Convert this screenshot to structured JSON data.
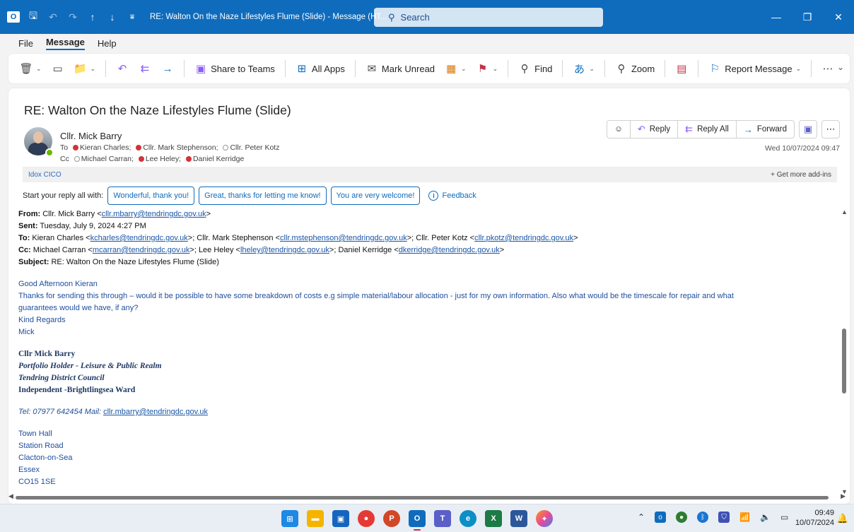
{
  "window": {
    "title": "RE: Walton On the Naze Lifestyles Flume (Slide)  -  Message (HT...",
    "search_placeholder": "Search",
    "controls": [
      "minimize-icon",
      "restore-icon",
      "close-icon"
    ]
  },
  "menu": {
    "items": [
      "File",
      "Message",
      "Help"
    ],
    "active": "Message"
  },
  "ribbon": {
    "share_to_teams": "Share to Teams",
    "all_apps": "All Apps",
    "mark_unread": "Mark Unread",
    "find": "Find",
    "zoom": "Zoom",
    "report_message": "Report Message"
  },
  "message": {
    "subject": "RE: Walton On the Naze Lifestyles Flume (Slide)",
    "sender": "Cllr. Mick Barry",
    "to_label": "To",
    "to": [
      {
        "name": "Kieran Charles;",
        "status": "busy"
      },
      {
        "name": "Cllr. Mark Stephenson;",
        "status": "busy"
      },
      {
        "name": "Cllr. Peter Kotz",
        "status": "offline"
      }
    ],
    "cc_label": "Cc",
    "cc": [
      {
        "name": "Michael Carran;",
        "status": "offline"
      },
      {
        "name": "Lee Heley;",
        "status": "busy"
      },
      {
        "name": "Daniel Kerridge",
        "status": "busy"
      }
    ],
    "date": "Wed 10/07/2024 09:47",
    "actions": {
      "reply": "Reply",
      "reply_all": "Reply All",
      "forward": "Forward"
    }
  },
  "addin": {
    "name": "Idox CICO",
    "more": "Get more add-ins"
  },
  "quick_reply": {
    "label": "Start your reply all with:",
    "options": [
      "Wonderful, thank you!",
      "Great, thanks for letting me know!",
      "You are very welcome!"
    ],
    "feedback": "Feedback"
  },
  "quoted": {
    "from_label": "From:",
    "from_name": "Cllr. Mick Barry <",
    "from_email": "cllr.mbarry@tendringdc.gov.uk",
    "from_tail": ">",
    "sent_label": "Sent:",
    "sent": "Tuesday, July 9, 2024 4:27 PM",
    "to_label": "To:",
    "to_1": "Kieran Charles <",
    "to_1_email": "kcharles@tendringdc.gov.uk",
    "to_2": ">; Cllr. Mark Stephenson <",
    "to_2_email": "cllr.mstephenson@tendringdc.gov.uk",
    "to_3": ">; Cllr. Peter Kotz <",
    "to_3_email": "cllr.pkotz@tendringdc.gov.uk",
    "to_tail": ">",
    "cc_label": "Cc:",
    "cc_1": "Michael Carran <",
    "cc_1_email": "mcarran@tendringdc.gov.uk",
    "cc_2": ">; Lee Heley <",
    "cc_2_email": "lheley@tendringdc.gov.uk",
    "cc_3": ">; Daniel Kerridge <",
    "cc_3_email": "dkerridge@tendringdc.gov.uk",
    "cc_tail": ">",
    "subject_label": "Subject:",
    "subject": "RE: Walton On the Naze Lifestyles Flume (Slide)"
  },
  "body": {
    "greeting": "Good Afternoon Kieran",
    "para_1": "Thanks for sending this through – would it be possible to have some breakdown of costs e.g simple material/labour allocation - just for my own information. Also what would be the timescale for repair and what",
    "para_2": "guarantees would we have, if any?",
    "regards": "Kind Regards",
    "name": "Mick"
  },
  "signature": {
    "name": "Cllr Mick Barry",
    "role": "Portfolio Holder - Leisure & Public Realm",
    "council": "Tendring District Council",
    "ward": "Independent -Brightlingsea Ward",
    "tel": "Tel: 07977 642454  Mail: ",
    "mail": "cllr.mbarry@tendringdc.gov.uk",
    "address": [
      "Town Hall",
      "Station Road",
      "Clacton-on-Sea",
      "Essex",
      "CO15 1SE"
    ]
  },
  "taskbar": {
    "time": "09:49",
    "date": "10/07/2024"
  }
}
